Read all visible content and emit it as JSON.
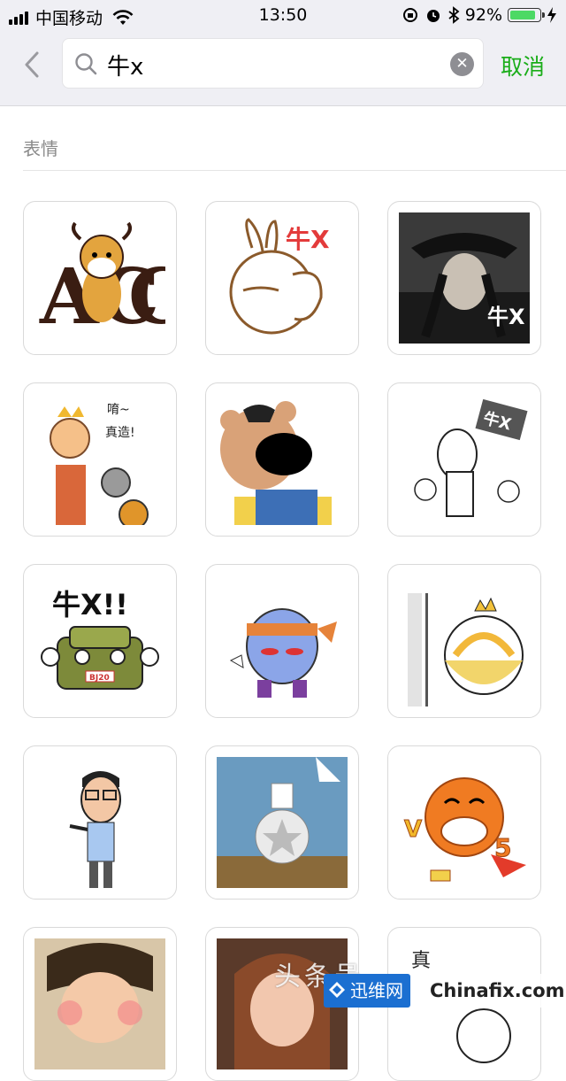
{
  "status_bar": {
    "carrier": "中国移动",
    "time": "13:50",
    "battery_percent": "92%",
    "battery_level": 0.92,
    "icons": [
      "signal-icon",
      "wifi-icon",
      "orientation-lock-icon",
      "alarm-icon",
      "bluetooth-icon",
      "battery-icon",
      "charging-icon"
    ]
  },
  "search": {
    "query": "牛x",
    "cancel_label": "取消"
  },
  "section": {
    "title": "表情"
  },
  "stickers": [
    {
      "name": "sticker-cow-abc",
      "letters": "AC"
    },
    {
      "name": "sticker-rabbit-facepalm",
      "caption": "牛X"
    },
    {
      "name": "sticker-pirate-photo",
      "caption": "牛X"
    },
    {
      "name": "sticker-monk-lifting",
      "caption": "唷~ 真造!"
    },
    {
      "name": "sticker-bear-overalls"
    },
    {
      "name": "sticker-llama-sign",
      "caption": "牛X"
    },
    {
      "name": "sticker-suv-thumbs-up",
      "caption": "牛X!!",
      "plate": "BJ20"
    },
    {
      "name": "sticker-ninja-blob"
    },
    {
      "name": "sticker-crown-ball"
    },
    {
      "name": "sticker-glasses-man"
    },
    {
      "name": "sticker-balloon-bust"
    },
    {
      "name": "sticker-orange-v5",
      "letters": "V5"
    },
    {
      "name": "sticker-girl-photo"
    },
    {
      "name": "sticker-woman-photo"
    },
    {
      "name": "sticker-partial",
      "caption": "真"
    }
  ],
  "watermark": {
    "headline": "头条号",
    "logo_text": "迅维网",
    "site": "Chinafix.com"
  }
}
